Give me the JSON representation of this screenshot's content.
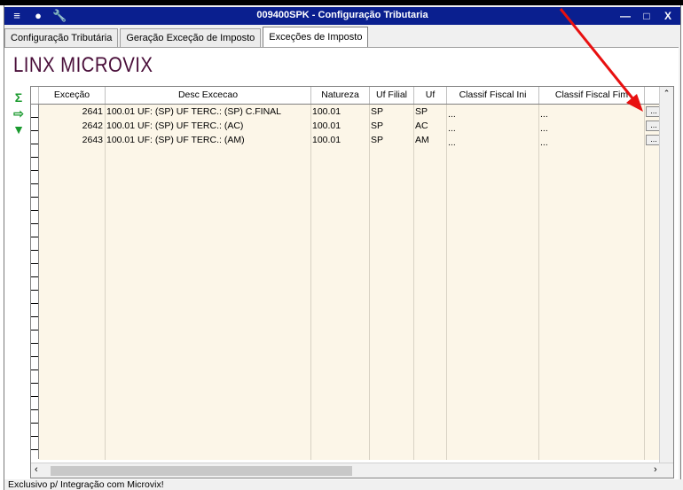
{
  "window": {
    "title": "009400SPK - Configuração Tributaria",
    "title_icons": [
      "window-menu-icon",
      "traffic-light-icon",
      "wrench-icon"
    ],
    "buttons": {
      "minimize": "—",
      "maximize": "□",
      "close": "X"
    }
  },
  "tabs": [
    {
      "label": "Configuração Tributária",
      "active": false
    },
    {
      "label": "Geração Exceção de Imposto",
      "active": false
    },
    {
      "label": "Exceções de Imposto",
      "active": true
    }
  ],
  "brand": {
    "logo_text": "LINX MICROVIX",
    "color": "#4a0f3a"
  },
  "side_toolbar": [
    "sum-icon",
    "export-icon",
    "expand-down-icon"
  ],
  "grid": {
    "columns": [
      "Exceção",
      "Desc Excecao",
      "Natureza",
      "Uf Filial",
      "Uf",
      "Classif Fiscal Ini",
      "Classif Fiscal Fim"
    ],
    "rows": [
      {
        "excecao": "2641",
        "desc": "100.01 UF: (SP) UF TERC.: (SP) C.FINAL",
        "natureza": "100.01",
        "uf_filial": "SP",
        "uf": "SP",
        "classif_ini": "...",
        "classif_fim": "...",
        "btn": "..."
      },
      {
        "excecao": "2642",
        "desc": "100.01 UF: (SP) UF TERC.: (AC)",
        "natureza": "100.01",
        "uf_filial": "SP",
        "uf": "AC",
        "classif_ini": "...",
        "classif_fim": "...",
        "btn": "..."
      },
      {
        "excecao": "2643",
        "desc": "100.01 UF: (SP) UF TERC.: (AM)",
        "natureza": "100.01",
        "uf_filial": "SP",
        "uf": "AM",
        "classif_ini": "...",
        "classif_fim": "...",
        "btn": "..."
      }
    ],
    "background": "#fcf6e8"
  },
  "status": {
    "text": "Exclusivo p/ Integração com Microvix!"
  },
  "annotation": {
    "arrow_color": "#e81010"
  }
}
